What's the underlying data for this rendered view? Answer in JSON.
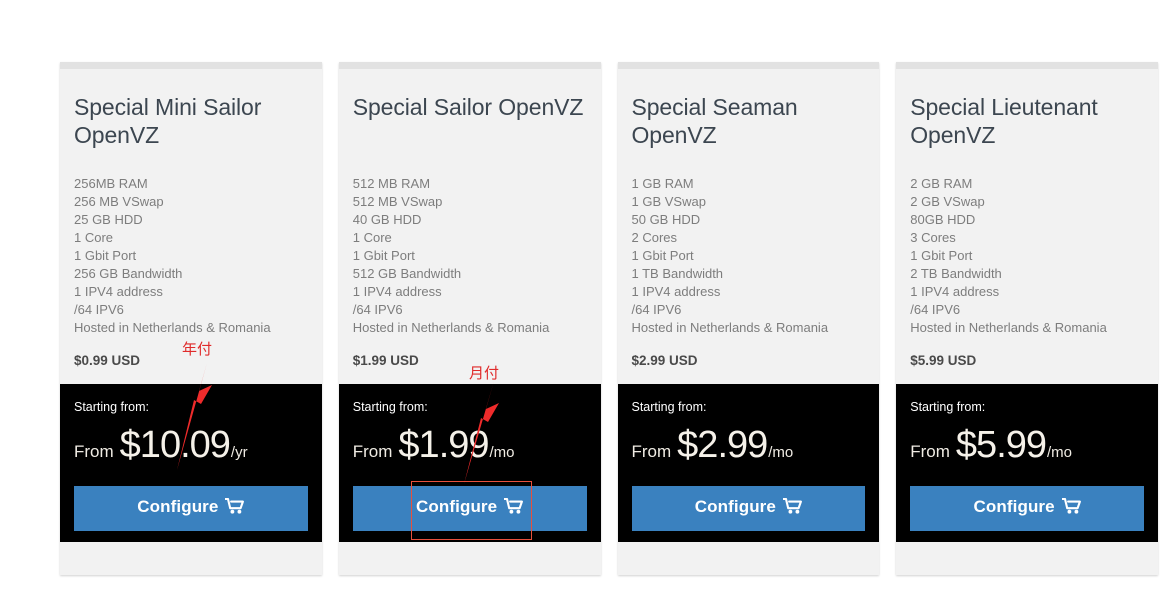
{
  "page": {
    "background": "#ffffff",
    "accent_blue": "#3a81bf",
    "card_bg": "#f2f2f2",
    "dark_bg": "#000000",
    "annotation_red": "#e02b2b"
  },
  "plans": [
    {
      "title": "Special Mini Sailor OpenVZ",
      "features": [
        "256MB RAM",
        "256 MB VSwap",
        "25 GB HDD",
        "1 Core",
        "1 Gbit Port",
        "256 GB Bandwidth",
        "1 IPV4 address",
        "/64 IPV6",
        "Hosted in Netherlands & Romania"
      ],
      "price_small": "$0.99 USD",
      "starting_label": "Starting from:",
      "price_from": "From",
      "price_main": "$10.09",
      "price_cycle": "/yr",
      "button_label": "Configure"
    },
    {
      "title": "Special Sailor OpenVZ",
      "features": [
        "512 MB RAM",
        "512 MB VSwap",
        "40 GB HDD",
        "1 Core",
        "1 Gbit Port",
        "512 GB Bandwidth",
        "1 IPV4 address",
        "/64 IPV6",
        "Hosted in Netherlands & Romania"
      ],
      "price_small": "$1.99 USD",
      "starting_label": "Starting from:",
      "price_from": "From",
      "price_main": "$1.99",
      "price_cycle": "/mo",
      "button_label": "Configure"
    },
    {
      "title": "Special Seaman OpenVZ",
      "features": [
        "1 GB RAM",
        "1 GB VSwap",
        "50 GB HDD",
        "2 Cores",
        "1 Gbit Port",
        "1 TB Bandwidth",
        "1 IPV4 address",
        "/64 IPV6",
        "Hosted in Netherlands & Romania"
      ],
      "price_small": "$2.99 USD",
      "starting_label": "Starting from:",
      "price_from": "From",
      "price_main": "$2.99",
      "price_cycle": "/mo",
      "button_label": "Configure"
    },
    {
      "title": "Special Lieutenant OpenVZ",
      "features": [
        "2 GB RAM",
        "2 GB VSwap",
        "80GB HDD",
        "3 Cores",
        "1 Gbit Port",
        "2 TB Bandwidth",
        "1 IPV4 address",
        "/64 IPV6",
        "Hosted in Netherlands & Romania"
      ],
      "price_small": "$5.99 USD",
      "starting_label": "Starting from:",
      "price_from": "From",
      "price_main": "$5.99",
      "price_cycle": "/mo",
      "button_label": "Configure"
    }
  ],
  "annotations": {
    "yearly_label": "年付",
    "monthly_label": "月付"
  },
  "icons": {
    "cart": "shopping-cart-icon"
  }
}
